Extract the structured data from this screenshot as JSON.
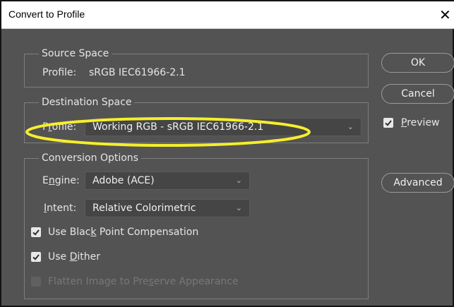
{
  "window": {
    "title": "Convert to Profile",
    "close_glyph": "✕"
  },
  "source_space": {
    "legend": "Source Space",
    "profile_label": "Profile:",
    "profile_value": "sRGB IEC61966-2.1"
  },
  "destination_space": {
    "legend": "Destination Space",
    "profile_label_parts": [
      "P",
      "r",
      "ofile:"
    ],
    "profile_selected": "Working RGB - sRGB IEC61966-2.1",
    "highlight_color": "#f5ef2b"
  },
  "conversion_options": {
    "legend": "Conversion Options",
    "engine_label_parts": [
      "E",
      "n",
      "gine:"
    ],
    "engine_selected": "Adobe (ACE)",
    "intent_label_parts": [
      "",
      "I",
      "ntent:"
    ],
    "intent_selected": "Relative Colorimetric",
    "checkboxes": [
      {
        "label_parts": [
          "Use Blac",
          "k",
          " Point Compensation"
        ],
        "checked": true,
        "enabled": true
      },
      {
        "label_parts": [
          "Use ",
          "D",
          "ither"
        ],
        "checked": true,
        "enabled": true
      },
      {
        "label_parts": [
          "Flatten Image to Pre",
          "s",
          "erve Appearance"
        ],
        "checked": false,
        "enabled": false
      }
    ]
  },
  "buttons": {
    "ok": "OK",
    "cancel": "Cancel",
    "preview_parts": [
      "",
      "P",
      "review"
    ],
    "preview_checked": true,
    "advanced": "Advanced"
  },
  "icons": {
    "dropdown": "chevron-down-icon",
    "checkmark": "checkmark-icon",
    "close": "close-icon"
  },
  "colors": {
    "dialog_bg": "#535353",
    "field_bg": "#454545",
    "text": "#e6e6e6"
  }
}
